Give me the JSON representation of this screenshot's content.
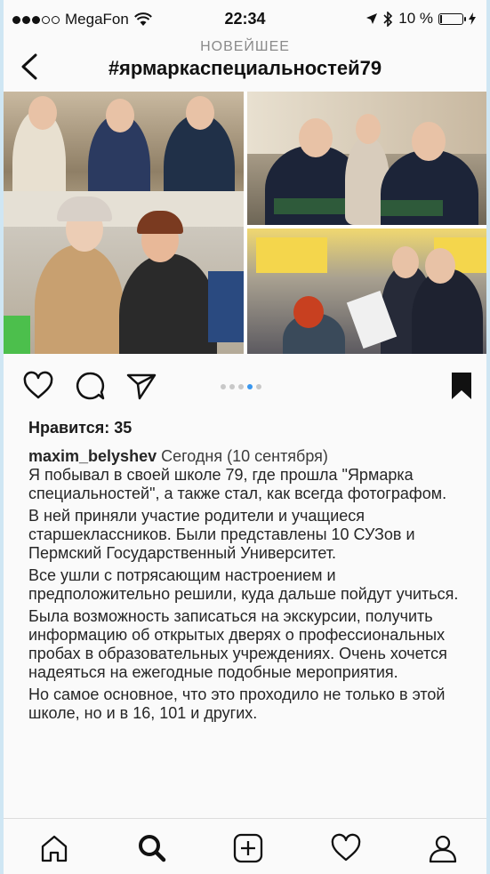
{
  "status_bar": {
    "carrier": "MegaFon",
    "time": "22:34",
    "battery_percent": "10 %",
    "battery_level": 0.1,
    "signal_bars_filled": 3,
    "signal_bars_total": 5
  },
  "header": {
    "subtitle": "НОВЕЙШЕЕ",
    "title": "#ярмаркаспециальностей79"
  },
  "post": {
    "carousel": {
      "total": 5,
      "active_index": 3
    },
    "likes_text": "Нравится: 35",
    "username": "maxim_belyshev",
    "date": "Сегодня (10 сентября)",
    "paragraphs": [
      "Я побывал в своей школе 79, где прошла \"Ярмарка специальностей\", а также стал, как всегда фотографом.",
      "В ней приняли участие родители и учащиеся старшеклассников. Были представлены 10 СУЗов и Пермский Государственный Университет.",
      "Все ушли с потрясающим настроением и предположительно решили, куда дальше пойдут учиться.",
      "Была возможность записаться на экскурсии, получить информацию об открытых дверях о профессиональных пробах в образовательных учреждениях. Очень хочется надеяться на ежегодные подобные мероприятия.",
      "Но самое основное, что это проходило не только в этой школе, но и в 16, 101 и других."
    ]
  },
  "icons": {
    "back": "chevron-left-icon",
    "like": "heart-icon",
    "comment": "comment-icon",
    "share": "send-icon",
    "save": "bookmark-icon",
    "tabs": [
      "home-icon",
      "search-icon",
      "add-icon",
      "activity-heart-icon",
      "profile-icon"
    ]
  },
  "colors": {
    "accent": "#3897f0",
    "text": "#262626",
    "muted": "#8a8a8a"
  }
}
